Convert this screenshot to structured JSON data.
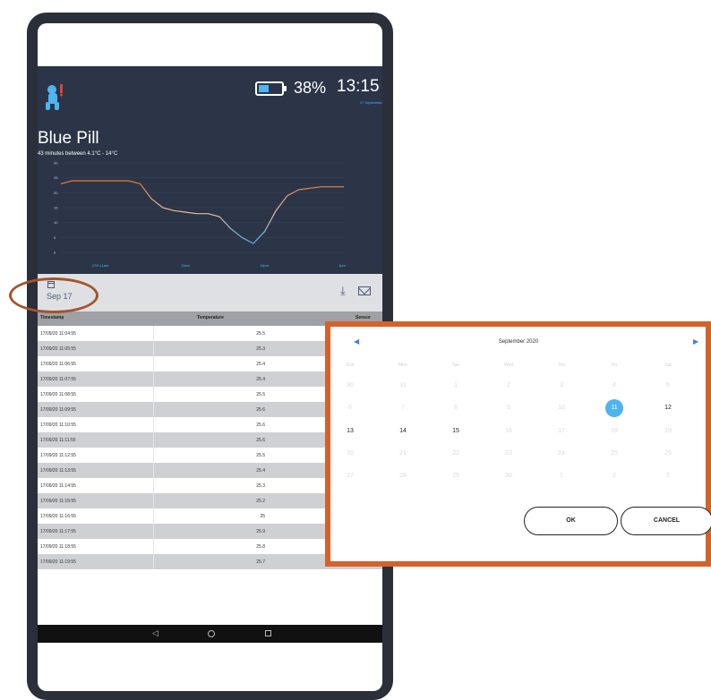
{
  "status_bar": {
    "battery_percent": "38%",
    "battery_level": 0.38,
    "time": "13:15",
    "date": "17 September"
  },
  "app": {
    "title": "Blue Pill",
    "subtitle": "43 minutes between 4.1°C - 14°C"
  },
  "chart_data": {
    "type": "line",
    "y_ticks": [
      "30",
      "25",
      "20",
      "15",
      "10",
      "5",
      "0"
    ],
    "x_ticks": [
      "27/9 11am",
      "11am",
      "12pm",
      "1pm"
    ],
    "ylim": [
      0,
      30
    ],
    "line_colors": [
      "#e07a3a",
      "#f0b8a0",
      "#4fb4f0"
    ],
    "series": [
      {
        "x": [
          0,
          4,
          8,
          12,
          16,
          20,
          24,
          28,
          32,
          36,
          40,
          44,
          48,
          52,
          56,
          60,
          64,
          68,
          72,
          76,
          80,
          84,
          88,
          92,
          96,
          100
        ],
        "values": [
          23,
          24,
          24,
          24,
          24,
          24,
          24,
          23,
          18,
          15,
          14,
          13.5,
          13,
          13,
          12,
          8,
          5,
          3,
          7,
          14,
          19,
          21,
          21.5,
          22,
          22,
          22
        ]
      }
    ]
  },
  "toolbar": {
    "date": "Sep 17"
  },
  "table": {
    "headers": [
      "Timestamp",
      "Temperature",
      "Sensor"
    ],
    "rows": [
      {
        "timestamp": "17/09/20 11:04:55",
        "temperature": "25.5"
      },
      {
        "timestamp": "17/09/20 11:05:55",
        "temperature": "25.3"
      },
      {
        "timestamp": "17/09/20 11:06:55",
        "temperature": "25.4"
      },
      {
        "timestamp": "17/09/20 11:07:55",
        "temperature": "25.4"
      },
      {
        "timestamp": "17/09/20 11:08:55",
        "temperature": "25.5"
      },
      {
        "timestamp": "17/09/20 11:09:55",
        "temperature": "25.6"
      },
      {
        "timestamp": "17/09/20 11:10:55",
        "temperature": "25.6"
      },
      {
        "timestamp": "17/09/20 11:11:55",
        "temperature": "25.6"
      },
      {
        "timestamp": "17/09/20 11:12:55",
        "temperature": "25.5"
      },
      {
        "timestamp": "17/09/20 11:13:55",
        "temperature": "25.4"
      },
      {
        "timestamp": "17/09/20 11:14:55",
        "temperature": "25.3"
      },
      {
        "timestamp": "17/09/20 11:15:55",
        "temperature": "25.2"
      },
      {
        "timestamp": "17/09/20 11:16:55",
        "temperature": "25"
      },
      {
        "timestamp": "17/09/20 11:17:55",
        "temperature": "25.9"
      },
      {
        "timestamp": "17/09/20 11:18:55",
        "temperature": "25.8"
      },
      {
        "timestamp": "17/09/20 11:19:55",
        "temperature": "25.7"
      }
    ]
  },
  "picker": {
    "month_title": "September 2020",
    "prev_icon": "chevron-left-icon",
    "next_icon": "chevron-right-icon",
    "day_names": [
      "Sun",
      "Mon",
      "Tue",
      "Wed",
      "Thu",
      "Fri",
      "Sat"
    ],
    "weeks": [
      [
        "30",
        "31",
        "1",
        "2",
        "3",
        "4",
        "5"
      ],
      [
        "6",
        "7",
        "8",
        "9",
        "10",
        "11",
        "12"
      ],
      [
        "13",
        "14",
        "15",
        "16",
        "17",
        "18",
        "19"
      ],
      [
        "20",
        "21",
        "22",
        "23",
        "24",
        "25",
        "26"
      ],
      [
        "27",
        "28",
        "29",
        "30",
        "1",
        "2",
        "3"
      ]
    ],
    "selected_day": "11",
    "ok_label": "OK",
    "cancel_label": "CANCEL"
  },
  "colors": {
    "header_bg": "#2b3547",
    "accent": "#4fb4f0",
    "highlight": "#d4622b"
  }
}
